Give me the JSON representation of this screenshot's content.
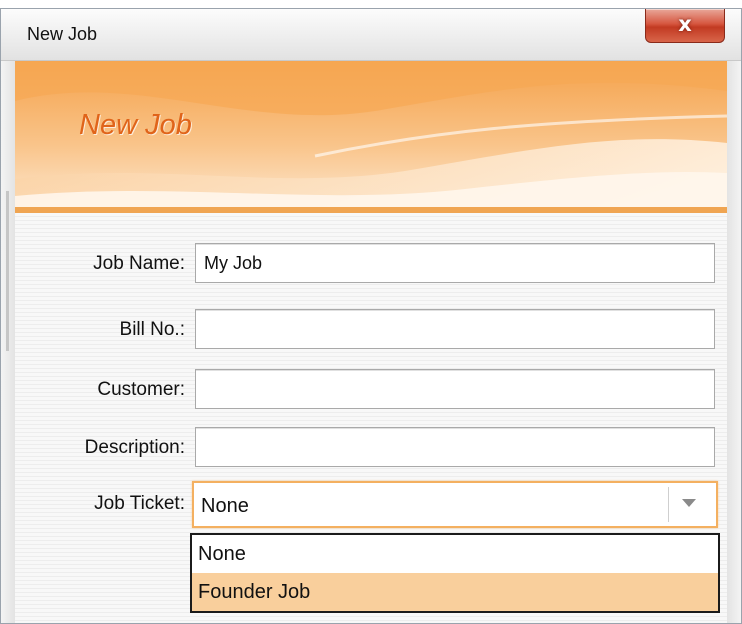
{
  "window": {
    "title": "New Job",
    "close_glyph": "x",
    "close_icon": "close-icon"
  },
  "banner": {
    "heading": "New Job"
  },
  "form": {
    "job_name": {
      "label": "Job Name:",
      "value": "My Job",
      "placeholder": ""
    },
    "bill_no": {
      "label": "Bill No.:",
      "value": "",
      "placeholder": ""
    },
    "customer": {
      "label": "Customer:",
      "value": "",
      "placeholder": ""
    },
    "description": {
      "label": "Description:",
      "value": "",
      "placeholder": ""
    },
    "job_ticket": {
      "label": "Job Ticket:",
      "selected": "None",
      "arrow_icon": "chevron-down-icon",
      "options": [
        "None",
        "Founder Job"
      ],
      "highlighted_option": "Founder Job"
    }
  },
  "colors": {
    "accent_orange": "#e0641a",
    "banner_orange": "#f5a24b",
    "focus_border": "#f4b060",
    "highlight": "#f9cf9c",
    "close_red": "#c23a22"
  }
}
